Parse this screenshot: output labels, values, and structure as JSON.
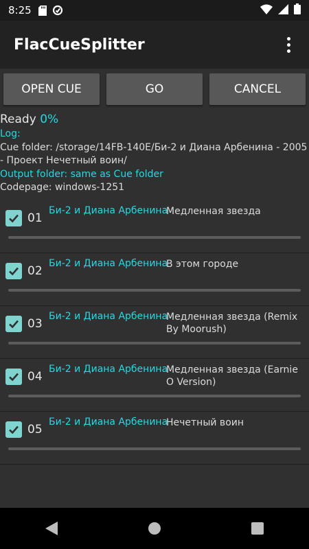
{
  "status_bar": {
    "time": "8:25"
  },
  "app": {
    "title": "FlacCueSplitter",
    "menu_icon": "more-vert-icon"
  },
  "buttons": {
    "open_cue": "OPEN CUE",
    "go": "GO",
    "cancel": "CANCEL"
  },
  "status": {
    "ready_label": "Ready",
    "percent": "0%",
    "log_label": "Log:",
    "cue_folder": "Cue folder: /storage/14FB-140E/Би-2 и Диана Арбенина - 2005 - Проект Нечетный воин/",
    "output_folder": "Output folder: same as Cue folder",
    "codepage": "Codepage: windows-1251"
  },
  "tracks": [
    {
      "number": "01",
      "artist": "Би-2 и Диана Арбенина",
      "title": "Медленная звезда",
      "checked": true,
      "progress": 0
    },
    {
      "number": "02",
      "artist": "Би-2 и Диана Арбенина",
      "title": "В этом городе",
      "checked": true,
      "progress": 0
    },
    {
      "number": "03",
      "artist": "Би-2 и Диана Арбенина",
      "title": "Медленная звезда (Remix By Moorush)",
      "checked": true,
      "progress": 0
    },
    {
      "number": "04",
      "artist": "Би-2 и Диана Арбенина",
      "title": "Медленная звезда (Earnie O Version)",
      "checked": true,
      "progress": 0
    },
    {
      "number": "05",
      "artist": "Би-2 и Диана Арбенина",
      "title": "Нечетный воин",
      "checked": true,
      "progress": 0
    }
  ],
  "colors": {
    "accent": "#26d9e3",
    "checkbox": "#7fd4cf",
    "background": "#303030",
    "appbar": "#222222"
  }
}
